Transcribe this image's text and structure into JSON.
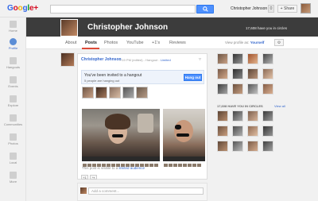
{
  "brand": {
    "logo_letters": [
      "G",
      "o",
      "o",
      "g",
      "l",
      "e"
    ],
    "logo_plus": "+"
  },
  "topbar": {
    "username": "Christopher Johnson",
    "notifications": "0",
    "share_label": "+ Share"
  },
  "nav": {
    "items": [
      {
        "label": "Home",
        "icon": "home-icon"
      },
      {
        "label": "Profile",
        "icon": "profile-icon"
      },
      {
        "label": "Hangouts",
        "icon": "hangouts-icon"
      },
      {
        "label": "Events",
        "icon": "events-icon"
      },
      {
        "label": "Explore",
        "icon": "explore-icon"
      },
      {
        "label": "Communities",
        "icon": "communities-icon"
      },
      {
        "label": "Photos",
        "icon": "photos-icon"
      },
      {
        "label": "Local",
        "icon": "local-icon"
      },
      {
        "label": "More",
        "icon": "more-icon"
      }
    ]
  },
  "profile": {
    "name": "Christopher Johnson",
    "circle_count": "17,608 have you in circles"
  },
  "tabs": [
    {
      "label": "About"
    },
    {
      "label": "Posts"
    },
    {
      "label": "Photos"
    },
    {
      "label": "YouTube"
    },
    {
      "label": "+1's"
    },
    {
      "label": "Reviews"
    }
  ],
  "view_as": {
    "prefix": "View profile as:",
    "value": "Yourself"
  },
  "post": {
    "author": "Christopher Johnson",
    "meta": "7:19 PM (edited) - Hangout - ",
    "meta_limited": "Limited",
    "menu": "▿",
    "hangout_title": "You've been invited to a hangout",
    "hangout_sub": "5 people are hanging out",
    "hangout_button": "Hang out",
    "visibility_prefix": "This post is visible to a ",
    "visibility_link": "limited audience",
    "plusone": "+1",
    "share_icon": "share-icon",
    "comment_placeholder": "Add a comment..."
  },
  "sidebar": {
    "circles_header": "17,608 HAVE YOU IN CIRCLES",
    "view_all": "View all"
  },
  "colors": {
    "accent": "#dd4b39",
    "link": "#3366cc",
    "button": "#4d90fe",
    "header": "#3c3c3c"
  }
}
